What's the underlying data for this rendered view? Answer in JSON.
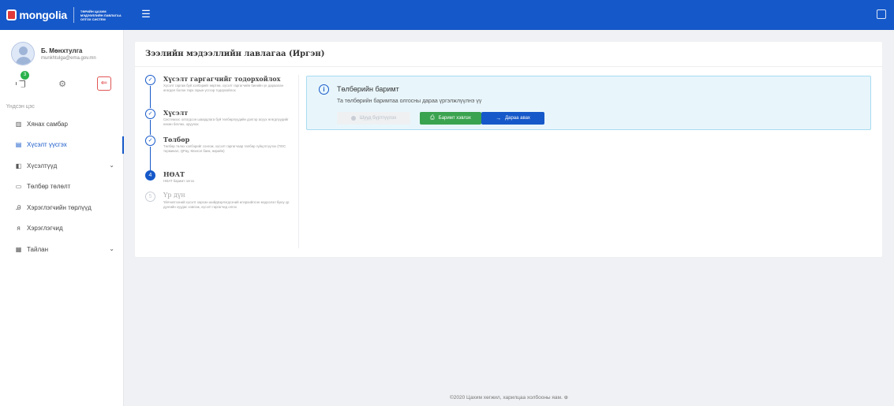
{
  "header": {
    "logo_text": "mongolia",
    "logo_subtitle": "ТӨРИЙН ЦАХИМ МЭДЭЭЛЛИЙН ЛАВЛАГАА ОЛГОХ СИСТЕМ",
    "menu_icon": "menu-toggle-icon",
    "right_icon": "expand-icon"
  },
  "user": {
    "name": "Б. Мөнхтулга",
    "email": "munkhtulga@ema.gov.mn",
    "notification_count": "3"
  },
  "sidebar": {
    "section_label": "Үндсэн цэс",
    "items": [
      {
        "label": "Хянах самбар",
        "icon": "chart-icon"
      },
      {
        "label": "Хүсэлт үүсгэх",
        "icon": "document-icon"
      },
      {
        "label": "Хүсэлтүүд",
        "icon": "list-icon"
      },
      {
        "label": "Төлбөр төлөлт",
        "icon": "card-icon"
      },
      {
        "label": "Хэрэглэгчийн төрлүүд",
        "icon": "user-type-icon"
      },
      {
        "label": "Хэрэглэгчид",
        "icon": "users-icon"
      },
      {
        "label": "Тайлан",
        "icon": "report-icon"
      }
    ]
  },
  "main": {
    "title": "Зээлийн мэдээллийн лавлагаа (Иргэн)",
    "steps": [
      {
        "number": "1",
        "title": "Хүсэлт гаргагчийг тодорхойлох",
        "desc": "Хүсэлт гаргаж буй хэлбэрийг өөртөө, хүсэлт гаргагчийн биеийн үе дараалан өгөгдөл болон төрх гарын үсгээр тодорхойлох",
        "status": "done"
      },
      {
        "number": "2",
        "title": "Хүсэлт",
        "desc": "Системээс олгогдсон шаардлага буй төлбөрлүүдийн дэлгэр асуух өгөгдлүүдийг нөхөн бөглөх, оруулах",
        "status": "done"
      },
      {
        "number": "3",
        "title": "Төлбөр",
        "desc": "Төлбөр төлөх хэлбэрийг сонгож, хүсэлт гаргагчаар төлбөр гүйцэтгүүлэх (ПОС терминал, QPay, Монгол банк, өөрийн)",
        "status": "done"
      },
      {
        "number": "4",
        "title": "НӨАТ",
        "desc": "НӨАТ баримт олгох",
        "status": "current"
      },
      {
        "number": "5",
        "title": "Үр дүн",
        "desc": "Үйлчилгээний хүсэлт харсан шийдвэрлэгдсэний илэрхийлсэн мэдээлэл буюу үр дүнгийн хуудас хэвлэж, хүсэлт гаргагчид олгох",
        "status": "pending"
      }
    ],
    "info": {
      "title": "Төлбөрийн баримт",
      "text": "Та төлбөрийн баримтаа олгосны дараа үргэлжлүүлнэ үү",
      "btn_disabled": "Шууд бүртгүүлэх",
      "btn_print": "Баримт хэвлэх",
      "btn_next": "Дараа авах"
    }
  },
  "footer": {
    "text": "©2020 Цахим хөгжил, харилцаа холбооны яам."
  }
}
